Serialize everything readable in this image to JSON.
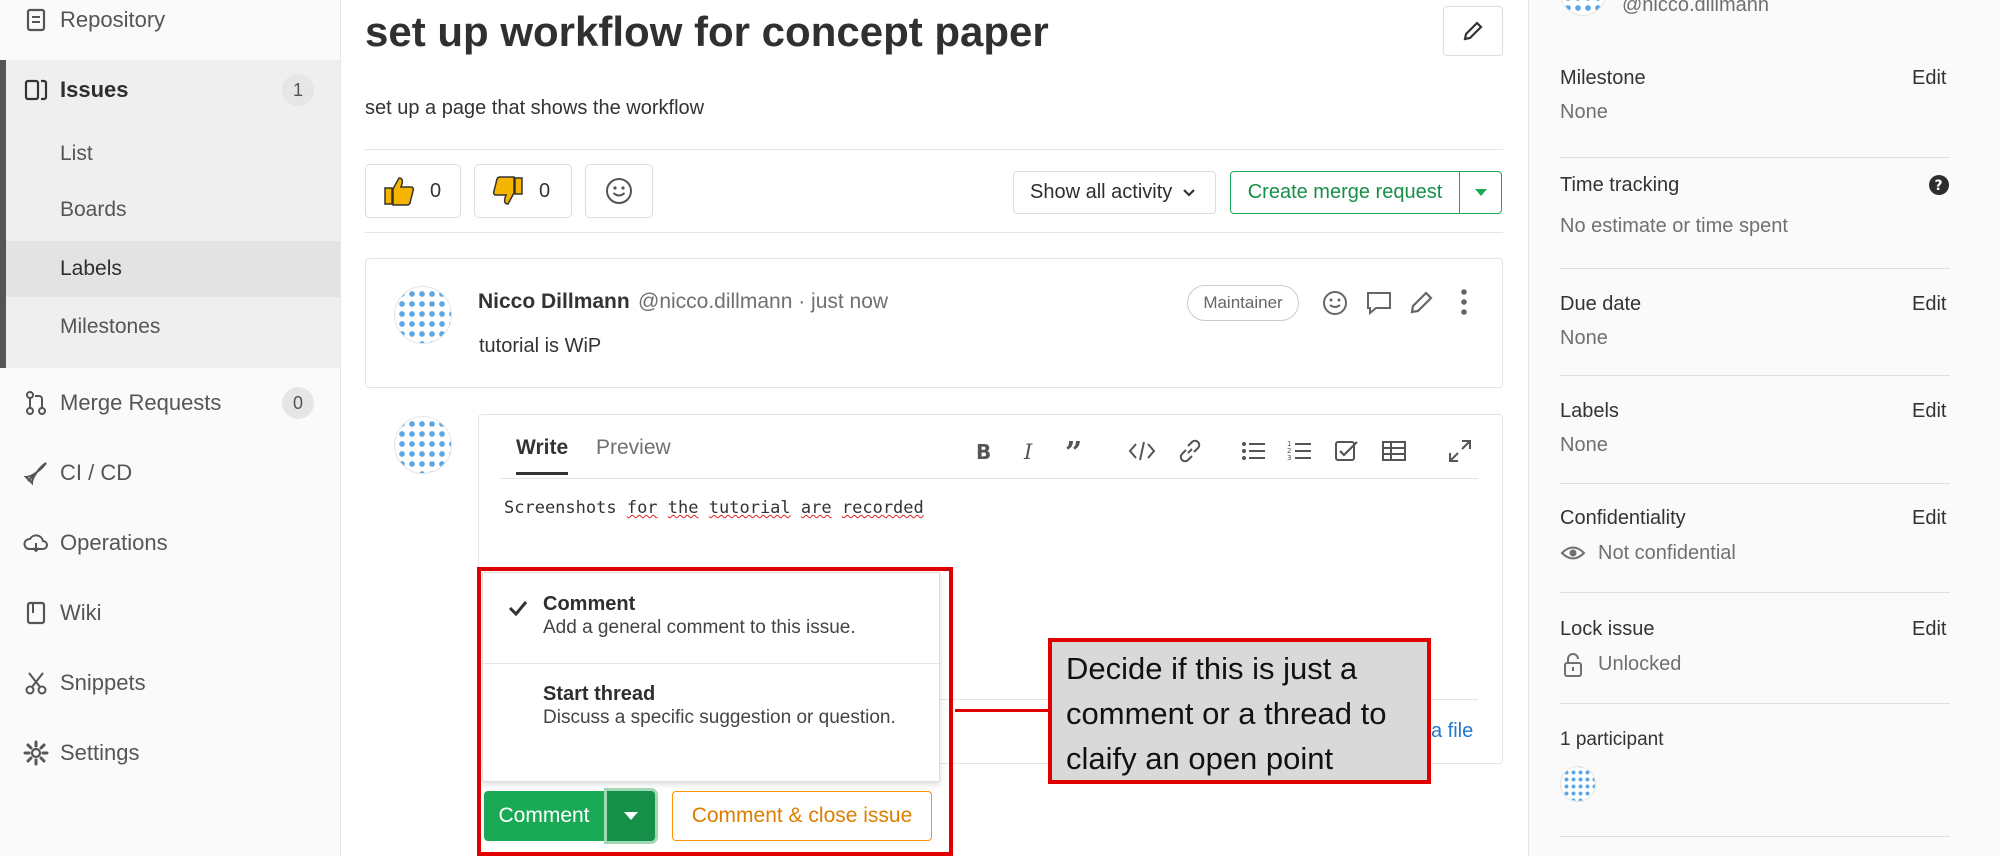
{
  "sidebar": {
    "repository": "Repository",
    "issues": {
      "label": "Issues",
      "count": "1"
    },
    "sub_items": [
      "List",
      "Boards",
      "Labels",
      "Milestones"
    ],
    "merge_requests": {
      "label": "Merge Requests",
      "count": "0"
    },
    "ci_cd": "CI / CD",
    "operations": "Operations",
    "wiki": "Wiki",
    "snippets": "Snippets",
    "settings": "Settings"
  },
  "issue": {
    "title": "set up workflow for concept paper",
    "description": "set up a page that shows the workflow",
    "thumbs_up_count": "0",
    "thumbs_down_count": "0",
    "show_activity": "Show all activity",
    "create_merge_request": "Create merge request"
  },
  "note": {
    "author": "Nicco Dillmann",
    "handle_time": "@nicco.dillmann · just now",
    "badge": "Maintainer",
    "text": "tutorial is WiP"
  },
  "editor": {
    "tab_write": "Write",
    "tab_preview": "Preview",
    "text_plain": "Screenshots ",
    "text_words": [
      "for",
      "the",
      "tutorial",
      "are",
      "recorded"
    ],
    "attach_partial": "a file"
  },
  "dropdown": {
    "option1_title": "Comment",
    "option1_desc": "Add a general comment to this issue.",
    "option2_title": "Start thread",
    "option2_desc": "Discuss a specific suggestion or question."
  },
  "buttons": {
    "comment": "Comment",
    "comment_close": "Comment & close issue"
  },
  "callout": {
    "text": "Decide if this is just a comment or a thread to claify an open point"
  },
  "right_sidebar": {
    "top_handle": "@nicco.dillmann",
    "milestone_label": "Milestone",
    "milestone_value": "None",
    "time_tracking_label": "Time tracking",
    "time_tracking_value": "No estimate or time spent",
    "due_date_label": "Due date",
    "due_date_value": "None",
    "labels_label": "Labels",
    "labels_value": "None",
    "confidentiality_label": "Confidentiality",
    "confidentiality_value": "Not confidential",
    "lock_label": "Lock issue",
    "lock_value": "Unlocked",
    "participants": "1 participant",
    "edit": "Edit"
  },
  "colors": {
    "green": "#1aaa55",
    "orange": "#fc9403",
    "annotation_red": "#e00000"
  }
}
